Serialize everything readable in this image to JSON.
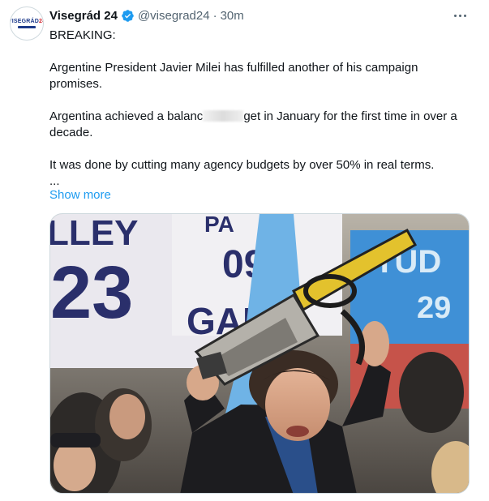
{
  "author": {
    "display_name": "Visegrád 24",
    "handle": "@visegrad24",
    "separator": "·",
    "time": "30m",
    "avatar_logo_text": "VISEGRÁD24"
  },
  "tweet": {
    "line1": "BREAKING:",
    "line2": "Argentine President Javier Milei has fulfilled another of his campaign promises.",
    "line3_part1": "Argentina achieved a balanc",
    "line3_part2": "get in January for the first time in over a decade.",
    "line4": "It was done by cutting many agency budgets by over 50% in real terms.",
    "ellipsis": "...",
    "show_more": "Show more"
  },
  "media": {
    "banner_left_text": "LLEY 23",
    "banner_center_text": "PA 09 GAN",
    "banner_right_text": "ITUD 29"
  },
  "icons": {
    "verified": "verified-badge-icon",
    "more": "more-options-icon"
  },
  "colors": {
    "link": "#1d9bf0",
    "secondary_text": "#536471",
    "verified": "#1d9bf0"
  }
}
